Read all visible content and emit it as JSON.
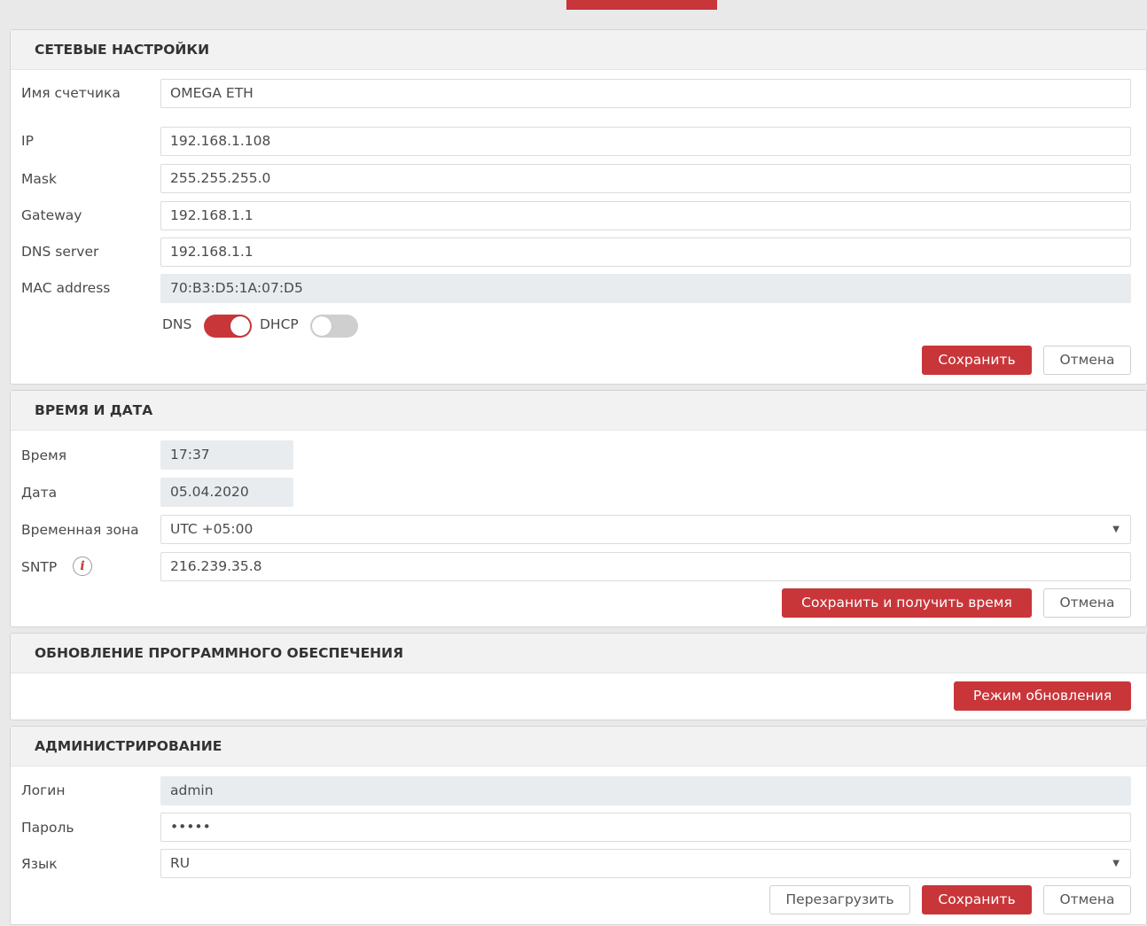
{
  "network": {
    "title": "СЕТЕВЫЕ НАСТРОЙКИ",
    "meter_name_label": "Имя счетчика",
    "meter_name_value": "OMEGA ETH",
    "ip_label": "IP",
    "ip_value": "192.168.1.108",
    "mask_label": "Mask",
    "mask_value": "255.255.255.0",
    "gateway_label": "Gateway",
    "gateway_value": "192.168.1.1",
    "dns_server_label": "DNS server",
    "dns_server_value": "192.168.1.1",
    "mac_label": "MAC address",
    "mac_value": "70:B3:D5:1A:07:D5",
    "dns_toggle_label": "DNS",
    "dns_toggle_on": true,
    "dhcp_toggle_label": "DHCP",
    "dhcp_toggle_on": false,
    "save_label": "Сохранить",
    "cancel_label": "Отмена"
  },
  "time": {
    "title": "ВРЕМЯ И ДАТА",
    "time_label": "Время",
    "time_value": "17:37",
    "date_label": "Дата",
    "date_value": "05.04.2020",
    "timezone_label": "Временная зона",
    "timezone_value": "UTC +05:00",
    "sntp_label": "SNTP",
    "sntp_value": "216.239.35.8",
    "save_get_time_label": "Сохранить и получить время",
    "cancel_label": "Отмена"
  },
  "firmware": {
    "title": "ОБНОВЛЕНИЕ ПРОГРАММНОГО ОБЕСПЕЧЕНИЯ",
    "update_mode_label": "Режим обновления"
  },
  "admin": {
    "title": "АДМИНИСТРИРОВАНИЕ",
    "login_label": "Логин",
    "login_value": "admin",
    "password_label": "Пароль",
    "password_value": "•••••",
    "language_label": "Язык",
    "language_value": "RU",
    "reboot_label": "Перезагрузить",
    "save_label": "Сохранить",
    "cancel_label": "Отмена"
  },
  "colors": {
    "accent": "#c8363a",
    "background": "#e9e9e9",
    "panel_header": "#f2f2f2",
    "readonly_field": "#e9ecef"
  },
  "icons": {
    "info": "info-icon",
    "dropdown": "chevron-down-icon"
  }
}
